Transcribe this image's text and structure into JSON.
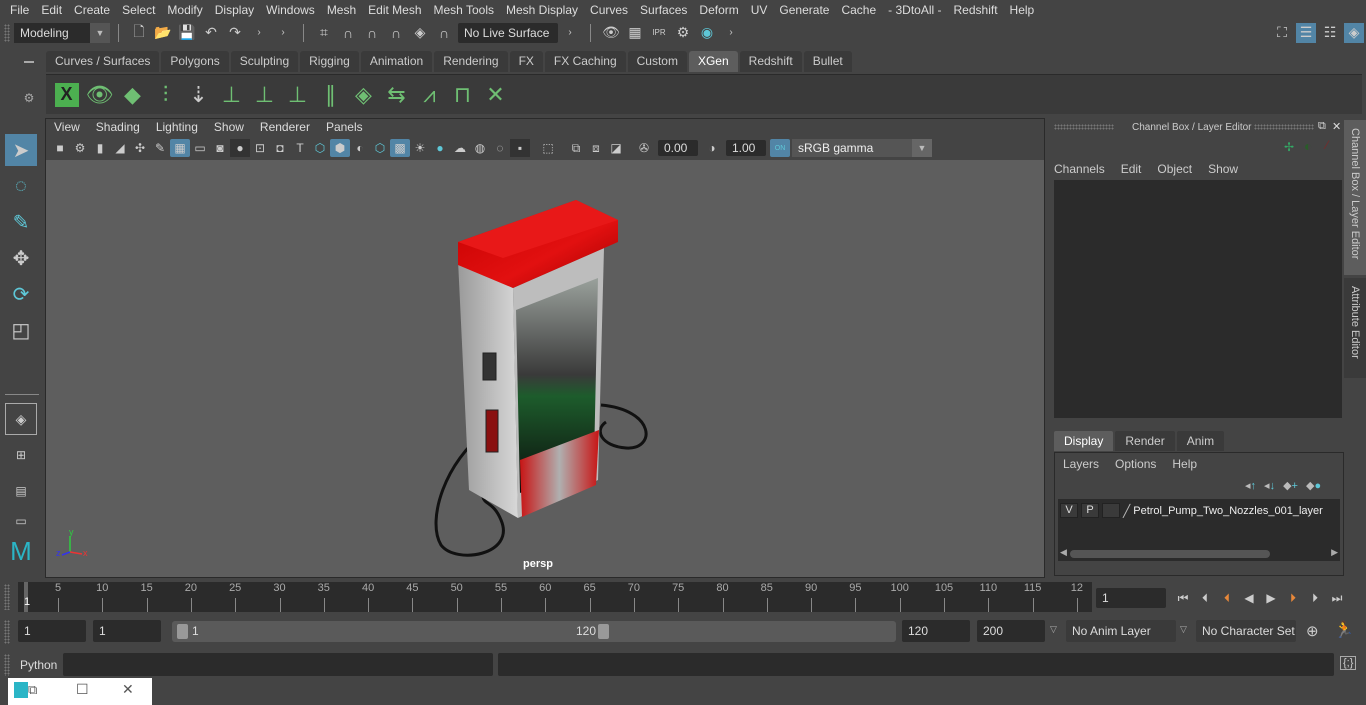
{
  "menubar": [
    "File",
    "Edit",
    "Create",
    "Select",
    "Modify",
    "Display",
    "Windows",
    "Mesh",
    "Edit Mesh",
    "Mesh Tools",
    "Mesh Display",
    "Curves",
    "Surfaces",
    "Deform",
    "UV",
    "Generate",
    "Cache",
    "- 3DtoAll -",
    "Redshift",
    "Help"
  ],
  "statusline": {
    "mode": "Modeling",
    "live_surface": "No Live Surface"
  },
  "shelf": {
    "tabs": [
      "Curves / Surfaces",
      "Polygons",
      "Sculpting",
      "Rigging",
      "Animation",
      "Rendering",
      "FX",
      "FX Caching",
      "Custom",
      "XGen",
      "Redshift",
      "Bullet"
    ],
    "active_tab": "XGen",
    "icons": [
      "xgen-description-editor-icon",
      "xgen-show-icon",
      "xgen-hide-icon",
      "xgen-add-guides-icon",
      "xgen-place-guides-icon",
      "xgen-add-guide-icon",
      "xgen-select-guide-icon",
      "xgen-lock-guide-icon",
      "xgen-sculpt-guides-icon",
      "xgen-create-layer-icon",
      "xgen-interactive-groom-icon",
      "xgen-select-guides-icon",
      "xgen-guide-frame-icon",
      "xgen-delete-guides-icon"
    ]
  },
  "panel": {
    "menu": [
      "View",
      "Shading",
      "Lighting",
      "Show",
      "Renderer",
      "Panels"
    ],
    "exposure": "0.00",
    "gamma": "1.00",
    "color_mgmt_badge": "ON",
    "color_space": "sRGB gamma",
    "camera_label": "persp",
    "axis": {
      "x": "x",
      "y": "y",
      "z": "z"
    }
  },
  "channel_box": {
    "title": "Channel Box / Layer Editor",
    "menu": [
      "Channels",
      "Edit",
      "Object",
      "Show"
    ],
    "layer_tabs": [
      "Display",
      "Render",
      "Anim"
    ],
    "active_layer_tab": "Display",
    "layer_menu": [
      "Layers",
      "Options",
      "Help"
    ],
    "layers": [
      {
        "visible": "V",
        "playback": "P",
        "name": "Petrol_Pump_Two_Nozzles_001_layer"
      }
    ]
  },
  "side_tabs": [
    "Channel Box / Layer Editor",
    "Attribute Editor"
  ],
  "timeline": {
    "ticks": [
      5,
      10,
      15,
      20,
      25,
      30,
      35,
      40,
      45,
      50,
      55,
      60,
      65,
      70,
      75,
      80,
      85,
      90,
      95,
      100,
      105,
      110,
      115,
      12
    ],
    "current_frame_marker": "1",
    "current_frame": "1",
    "start_frame": "1",
    "playback_start": "1",
    "range_start_label": "1",
    "range_end_label": "120",
    "playback_end": "120",
    "end_frame": "200",
    "anim_layer": "No Anim Layer",
    "character_set": "No Character Set"
  },
  "command_line": {
    "language": "Python",
    "input": "",
    "result": ""
  },
  "window_controls": {
    "restore": "restore-icon",
    "maximize": "maximize-icon",
    "close": "close-icon"
  }
}
